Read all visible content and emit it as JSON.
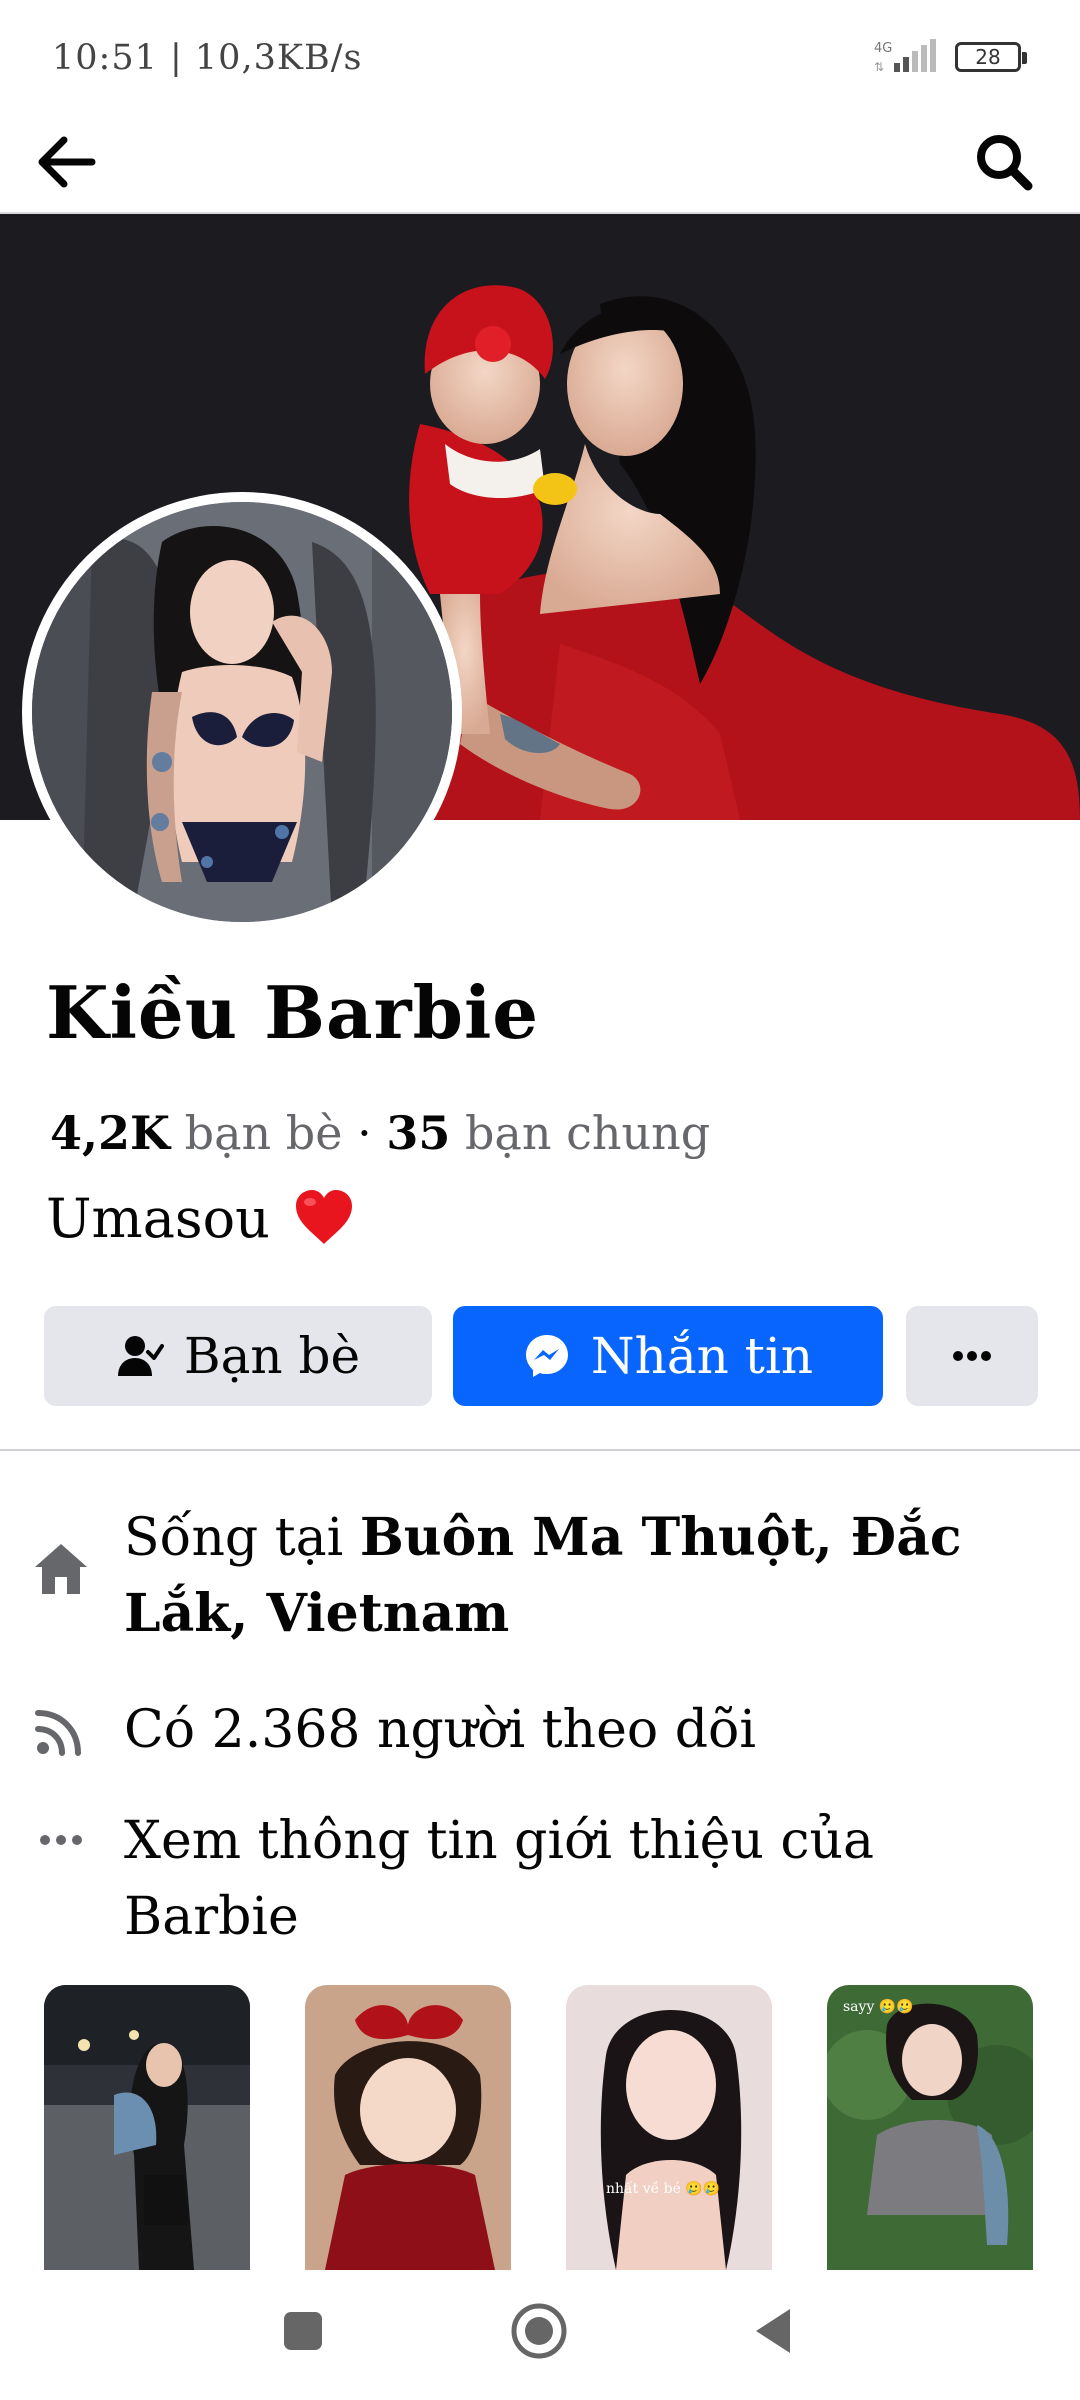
{
  "status_bar": {
    "time_speed": "10:51 | 10,3KB/s",
    "network": "4G",
    "battery": "28"
  },
  "profile": {
    "name": "Kiều Barbie",
    "friends_count": "4,2K",
    "friends_label": "bạn bè",
    "separator": "·",
    "mutual_count": "35",
    "mutual_label": "bạn chung",
    "bio": "Umasou",
    "bio_emoji": "heart-emoji"
  },
  "buttons": {
    "friends": "Bạn bè",
    "message": "Nhắn tin",
    "more": "more-icon"
  },
  "info": {
    "lives_prefix": "Sống tại ",
    "lives_place": "Buôn Ma Thuột, Đắc Lắk, Vietnam",
    "followers": "Có 2.368 người theo dõi",
    "about": "Xem thông tin giới thiệu của Barbie"
  },
  "photos": [
    {
      "caption": ""
    },
    {
      "caption": ""
    },
    {
      "caption": "nhất về bé 🥲🥲"
    },
    {
      "caption": "sayy 🥲🥲"
    }
  ],
  "colors": {
    "accent": "#0866ff",
    "button_gray": "#e4e6eb",
    "text_secondary": "#65676b"
  },
  "icons": [
    "back-arrow-icon",
    "search-icon",
    "add-friend-icon",
    "messenger-icon",
    "more-icon",
    "home-icon",
    "rss-icon",
    "ellipsis-icon",
    "recent-apps-icon",
    "home-button-icon",
    "back-button-icon"
  ]
}
